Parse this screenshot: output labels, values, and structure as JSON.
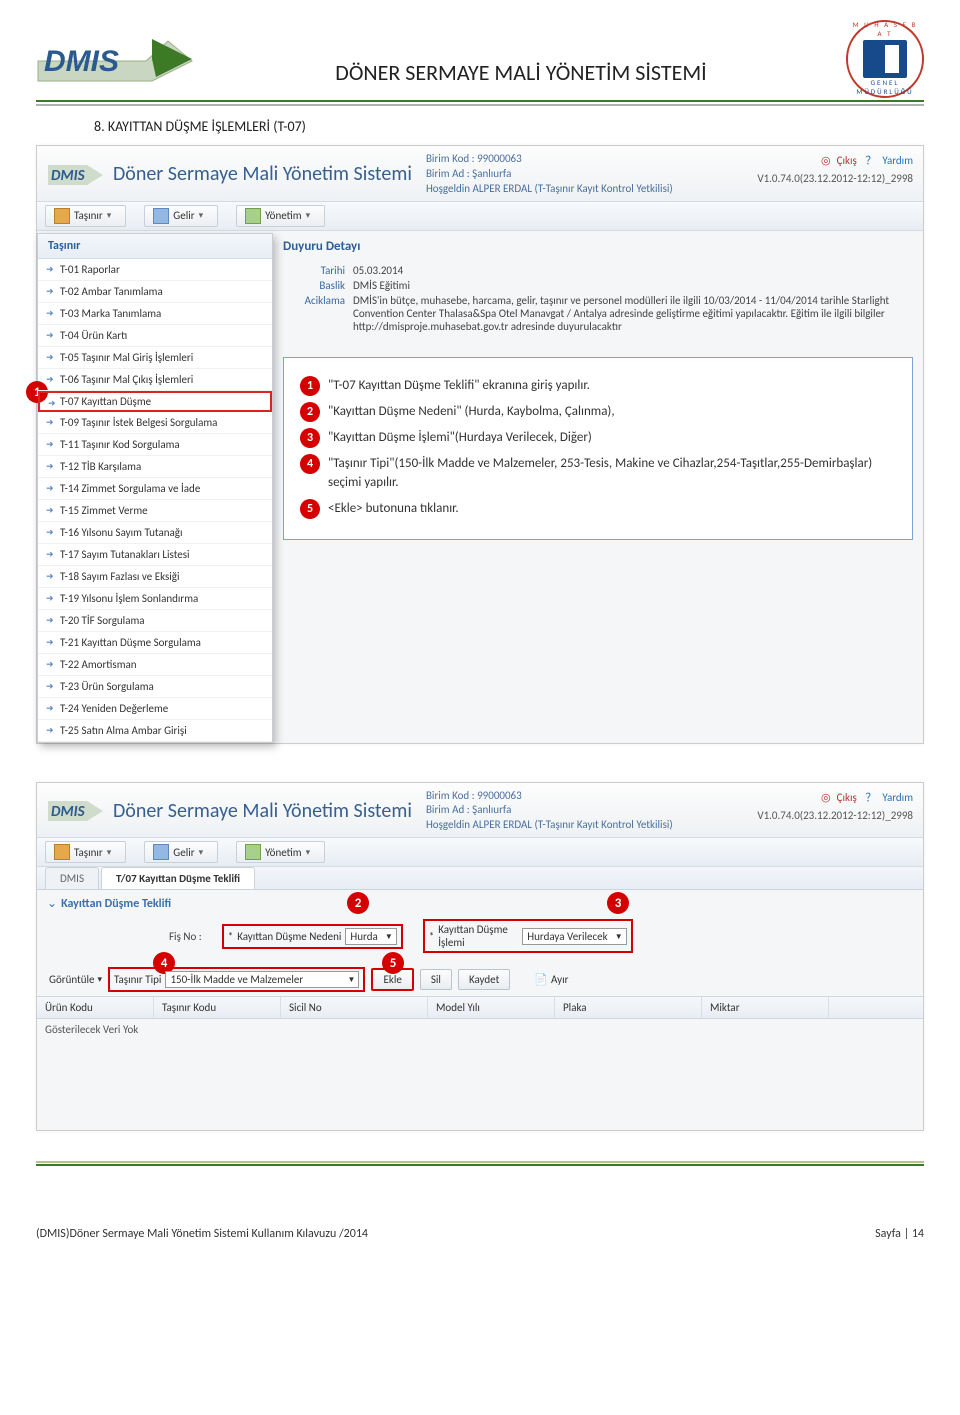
{
  "page_header": {
    "title": "DÖNER SERMAYE MALİ YÖNETİM SİSTEMİ",
    "muhasebat_top": "M U H A S E B A T",
    "muhasebat_bottom": "GENEL MÜDÜRLÜĞÜ",
    "logo_text": "DMIS"
  },
  "section": {
    "number": "8.",
    "title_caps": "KAYITTAN DÜŞME İŞLEMLERİ",
    "title_suffix": "(T-07)"
  },
  "app": {
    "title": "Döner Sermaye Mali Yönetim Sistemi",
    "birim_kod_label": "Birim Kod :",
    "birim_kod": "99000063",
    "birim_ad_label": "Birim Ad :",
    "birim_ad": "Şanlıurfa",
    "welcome": "Hoşgeldin ALPER ERDAL (T-Taşınır Kayıt Kontrol Yetkilisi)",
    "exit_label": "Çıkış",
    "help_label": "Yardım",
    "version": "V1.0.74.0(23.12.2012-12:12)_2998"
  },
  "toolbar": {
    "tasinir": "Taşınır",
    "gelir": "Gelir",
    "yonetim": "Yönetim"
  },
  "dropdown": {
    "title": "Taşınır",
    "items": [
      "T-01 Raporlar",
      "T-02 Ambar Tanımlama",
      "T-03 Marka Tanımlama",
      "T-04 Ürün Kartı",
      "T-05 Taşınır Mal Giriş İşlemleri",
      "T-06 Taşınır Mal Çıkış İşlemleri",
      "T-07 Kayıttan Düşme",
      "T-09 Taşınır İstek Belgesi Sorgulama",
      "T-11 Taşınır Kod Sorgulama",
      "T-12 TİB Karşılama",
      "T-14 Zimmet Sorgulama ve İade",
      "T-15 Zimmet Verme",
      "T-16 Yılsonu Sayım Tutanağı",
      "T-17 Sayım Tutanakları Listesi",
      "T-18 Sayım Fazlası ve Eksiği",
      "T-19 Yılsonu İşlem Sonlandırma",
      "T-20 TİF Sorgulama",
      "T-21 Kayıttan Düşme Sorgulama",
      "T-22 Amortisman",
      "T-23 Ürün Sorgulama",
      "T-24 Yeniden Değerleme",
      "T-25 Satın Alma Ambar Girişi"
    ],
    "highlight_index": 6
  },
  "duyuru": {
    "heading": "Duyuru Detayı",
    "tarih_label": "Tarihi",
    "tarih": "05.03.2014",
    "baslik_label": "Baslik",
    "baslik": "DMİS Eğitimi",
    "aciklama_label": "Aciklama",
    "aciklama": "DMİS'in bütçe, muhasebe, harcama, gelir, taşınır ve personel modülleri ile ilgili 10/03/2014 - 11/04/2014 tarihle Starlight Convention Center Thalasa&Spa Otel Manavgat / Antalya adresinde geliştirme eğitimi yapılacaktır. Eğitim ile ilgili bilgiler http://dmisproje.muhasebat.gov.tr adresinde duyurulacaktır"
  },
  "guide": {
    "steps": [
      "\"T-07 Kayıttan Düşme Teklifi\" ekranına giriş yapılır.",
      "\"Kayıttan Düşme Nedeni\" (Hurda, Kaybolma, Çalınma),",
      "\"Kayıttan Düşme İşlemi\"(Hurdaya Verilecek, Diğer)",
      "\"Taşınır Tipi\"(150-İlk Madde ve Malzemeler, 253-Tesis, Makine ve Cihazlar,254-Taşıtlar,255-Demirbaşlar) seçimi yapılır.",
      "<Ekle> butonuna tıklanır."
    ]
  },
  "tabs": {
    "root": "DMIS",
    "active": "T/07 Kayıttan Düşme Teklifi"
  },
  "panel": {
    "title": "Kayıttan Düşme Teklifi",
    "fis_no_label": "Fiş No :",
    "neden_label": "Kayıttan Düşme Nedeni",
    "neden_value": "Hurda",
    "islem_label": "Kayıttan Düşme İşlemi",
    "islem_value": "Hurdaya Verilecek",
    "goruntule": "Görüntüle",
    "tasinir_tipi_label": "Taşınır Tipi",
    "tasinir_tipi_value": "150-İlk Madde ve Malzemeler",
    "btn_ekle": "Ekle",
    "btn_sil": "Sil",
    "btn_kaydet": "Kaydet",
    "btn_ayir": "Ayır"
  },
  "grid": {
    "headers": [
      "Ürün Kodu",
      "Taşınır Kodu",
      "Sicil No",
      "Model Yılı",
      "Plaka",
      "Miktar"
    ],
    "empty": "Gösterilecek Veri Yok"
  },
  "footer": {
    "left": "(DMIS)Döner Sermaye Mali Yönetim Sistemi Kullanım Kılavuzu /2014",
    "right": "Sayfa | 14"
  },
  "markers": {
    "m1": "1",
    "m2": "2",
    "m3": "3",
    "m4": "4",
    "m5": "5"
  }
}
